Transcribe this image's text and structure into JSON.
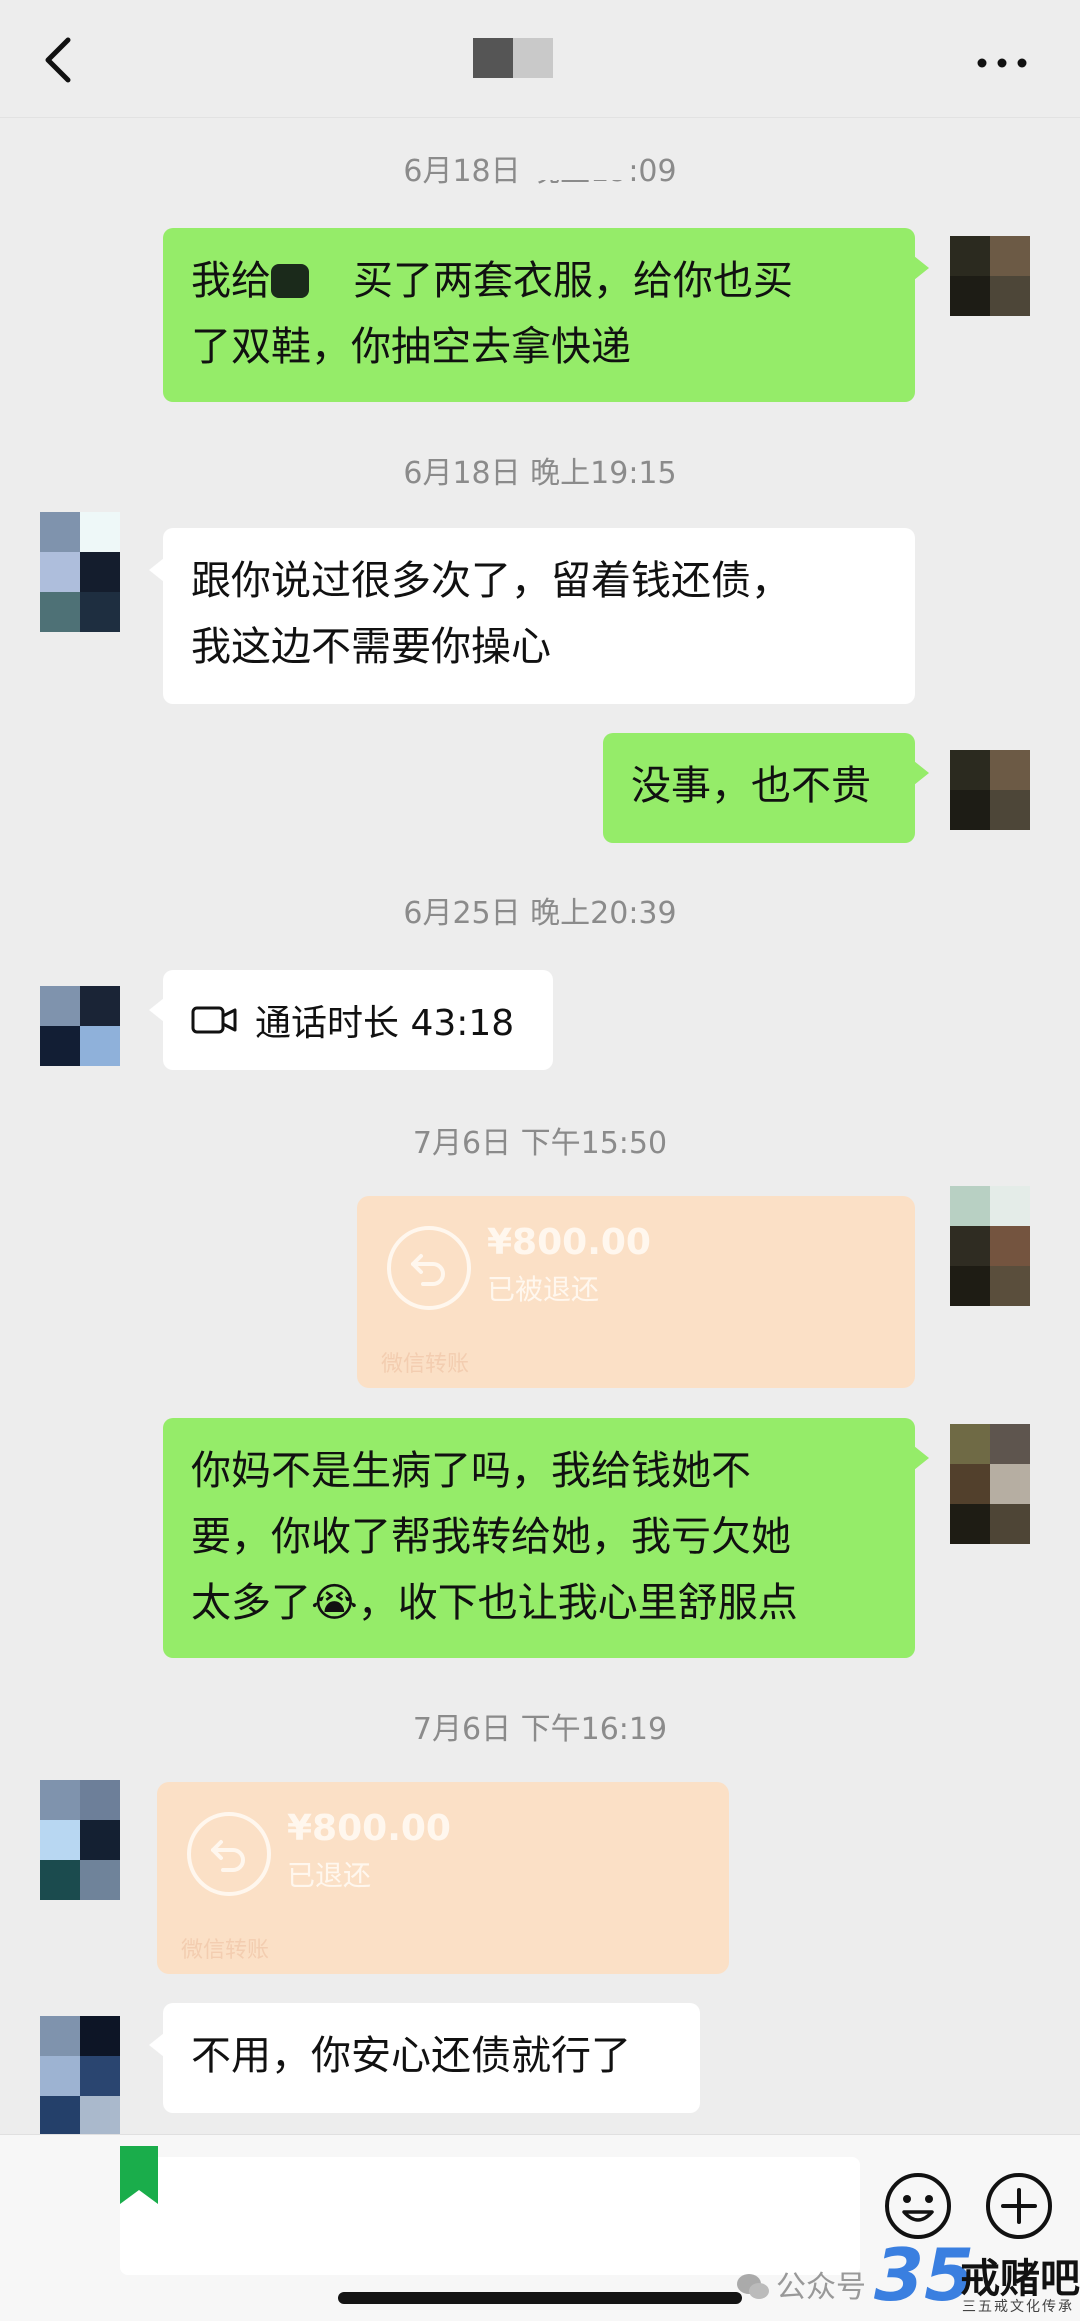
{
  "header": {
    "back_icon": "chevron-left-icon",
    "more_icon": "more-dots-icon"
  },
  "messages": {
    "ts_1": "6月18日 晚上19:09",
    "msg_1_line1_a": "我给",
    "msg_1_line1_b": "买了两套衣服，给你也买",
    "msg_1_line2": "了双鞋，你抽空去拿快递",
    "ts_2": "6月18日 晚上19:15",
    "msg_2_line1": "跟你说过很多次了，留着钱还债，",
    "msg_2_line2": "我这边不需要你操心",
    "msg_3": "没事，也不贵",
    "ts_3": "6月25日 晚上20:39",
    "call_label": "通话时长 43:18",
    "ts_4": "7月6日 下午15:50",
    "transfer_1": {
      "amount": "¥800.00",
      "status": "已被退还",
      "footer": "微信转账"
    },
    "msg_4_line1": "你妈不是生病了吗，我给钱她不",
    "msg_4_line2": "要，你收了帮我转给她，我亏欠她",
    "msg_4_line3_a": "太多了",
    "msg_4_emoji": "😭",
    "msg_4_line3_b": "，收下也让我心里舒服点",
    "ts_5": "7月6日 下午16:19",
    "transfer_2": {
      "amount": "¥800.00",
      "status": "已退还",
      "footer": "微信转账"
    },
    "msg_5": "不用，你安心还债就行了"
  },
  "input": {
    "emoji_icon": "emoji-smile-icon",
    "plus_icon": "plus-circle-icon"
  },
  "watermark": {
    "prefix": "公众号",
    "number": "35",
    "name": "戒赌吧",
    "sub": "三五戒文化传承"
  },
  "colors": {
    "bg": "#ededed",
    "my_bubble": "#95ec69",
    "their_bubble": "#ffffff",
    "transfer": "#fbe0c6"
  }
}
